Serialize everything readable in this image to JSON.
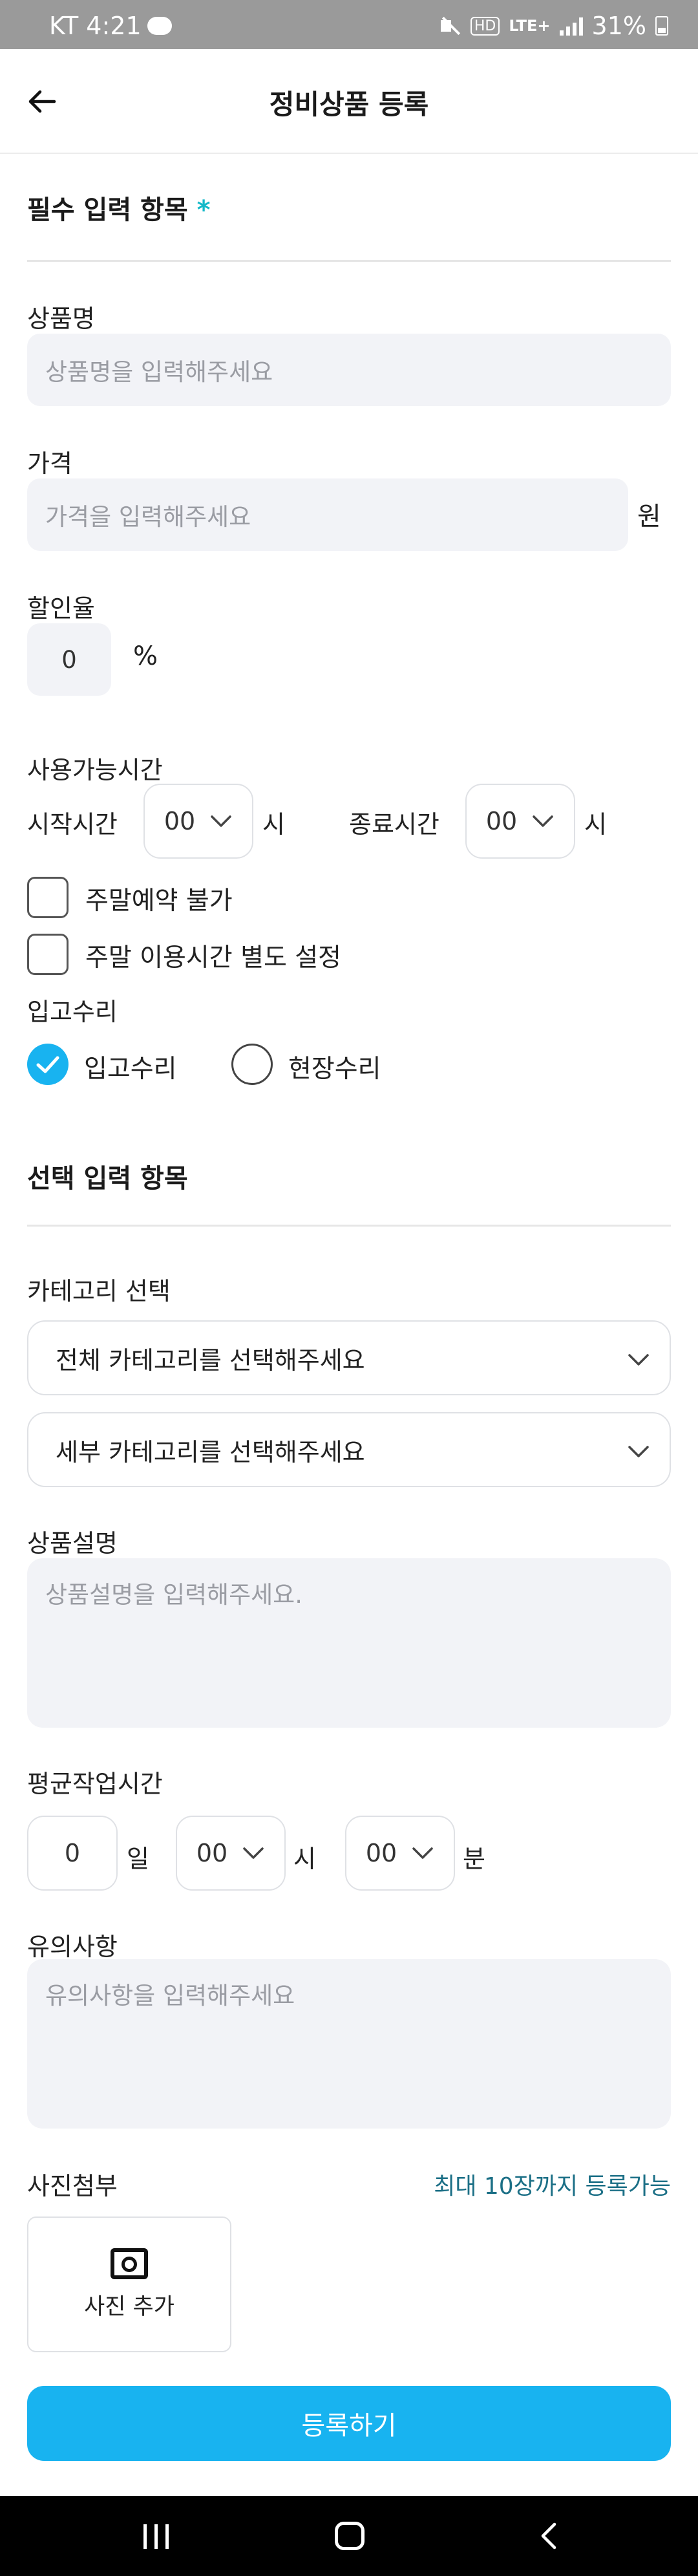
{
  "status_bar": {
    "carrier": "KT",
    "time": "4:21",
    "hd": "HD",
    "lte": "LTE+",
    "battery": "31%"
  },
  "header": {
    "title": "정비상품 등록"
  },
  "required_section": {
    "title": "필수 입력 항목",
    "required_mark": "*",
    "product_name": {
      "label": "상품명",
      "placeholder": "상품명을 입력해주세요"
    },
    "price": {
      "label": "가격",
      "placeholder": "가격을 입력해주세요",
      "suffix": "원"
    },
    "discount": {
      "label": "할인율",
      "value": "0",
      "suffix": "%"
    },
    "hours": {
      "label": "사용가능시간",
      "start_label": "시작시간",
      "start_value": "00",
      "start_suffix": "시",
      "end_label": "종료시간",
      "end_value": "00",
      "end_suffix": "시"
    },
    "checkboxes": [
      {
        "label": "주말예약 불가",
        "checked": false
      },
      {
        "label": "주말 이용시간 별도 설정",
        "checked": false
      }
    ],
    "repair": {
      "label": "입고수리",
      "options": [
        {
          "label": "입고수리",
          "selected": true
        },
        {
          "label": "현장수리",
          "selected": false
        }
      ]
    }
  },
  "optional_section": {
    "title": "선택 입력 항목",
    "category": {
      "label": "카테고리 선택",
      "main_placeholder": "전체 카테고리를 선택해주세요",
      "sub_placeholder": "세부 카테고리를 선택해주세요"
    },
    "description": {
      "label": "상품설명",
      "placeholder": "상품설명을 입력해주세요."
    },
    "work_time": {
      "label": "평균작업시간",
      "days_value": "0",
      "days_suffix": "일",
      "hours_value": "00",
      "hours_suffix": "시",
      "minutes_value": "00",
      "minutes_suffix": "분"
    },
    "notes": {
      "label": "유의사항",
      "placeholder": "유의사항을 입력해주세요"
    },
    "photos": {
      "label": "사진첨부",
      "limit_text": "최대 10장까지 등록가능",
      "add_label": "사진 추가"
    }
  },
  "submit_label": "등록하기",
  "colors": {
    "accent": "#18b3f0",
    "star": "#14b8c8",
    "link": "#1b6f86",
    "input_bg": "#f2f3f7"
  },
  "icons": [
    "back-arrow-icon",
    "chevron-down-icon",
    "camera-icon",
    "check-icon",
    "recent-apps-icon",
    "home-icon",
    "nav-back-icon"
  ]
}
